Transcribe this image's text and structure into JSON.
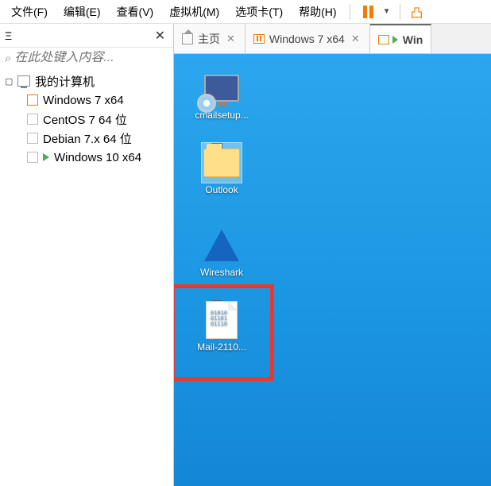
{
  "menu": {
    "file": "文件(F)",
    "edit": "编辑(E)",
    "view": "查看(V)",
    "vm": "虚拟机(M)",
    "tabs": "选项卡(T)",
    "help": "帮助(H)"
  },
  "sidebar": {
    "close": "✕",
    "search_placeholder": "在此处键入内容...",
    "root": "我的计算机",
    "items": [
      {
        "label": "Windows 7 x64",
        "state": "running-orange"
      },
      {
        "label": "CentOS 7 64 位",
        "state": "off"
      },
      {
        "label": "Debian 7.x 64 位",
        "state": "off"
      },
      {
        "label": "Windows 10 x64",
        "state": "running-green"
      }
    ]
  },
  "tabs": {
    "home": "主页",
    "t1": "Windows 7 x64",
    "t2": "Win"
  },
  "desktop": {
    "icons": [
      {
        "label": "cmailsetup..."
      },
      {
        "label": "Outlook"
      },
      {
        "label": "Wireshark"
      },
      {
        "label": "Mail-2110..."
      }
    ]
  }
}
